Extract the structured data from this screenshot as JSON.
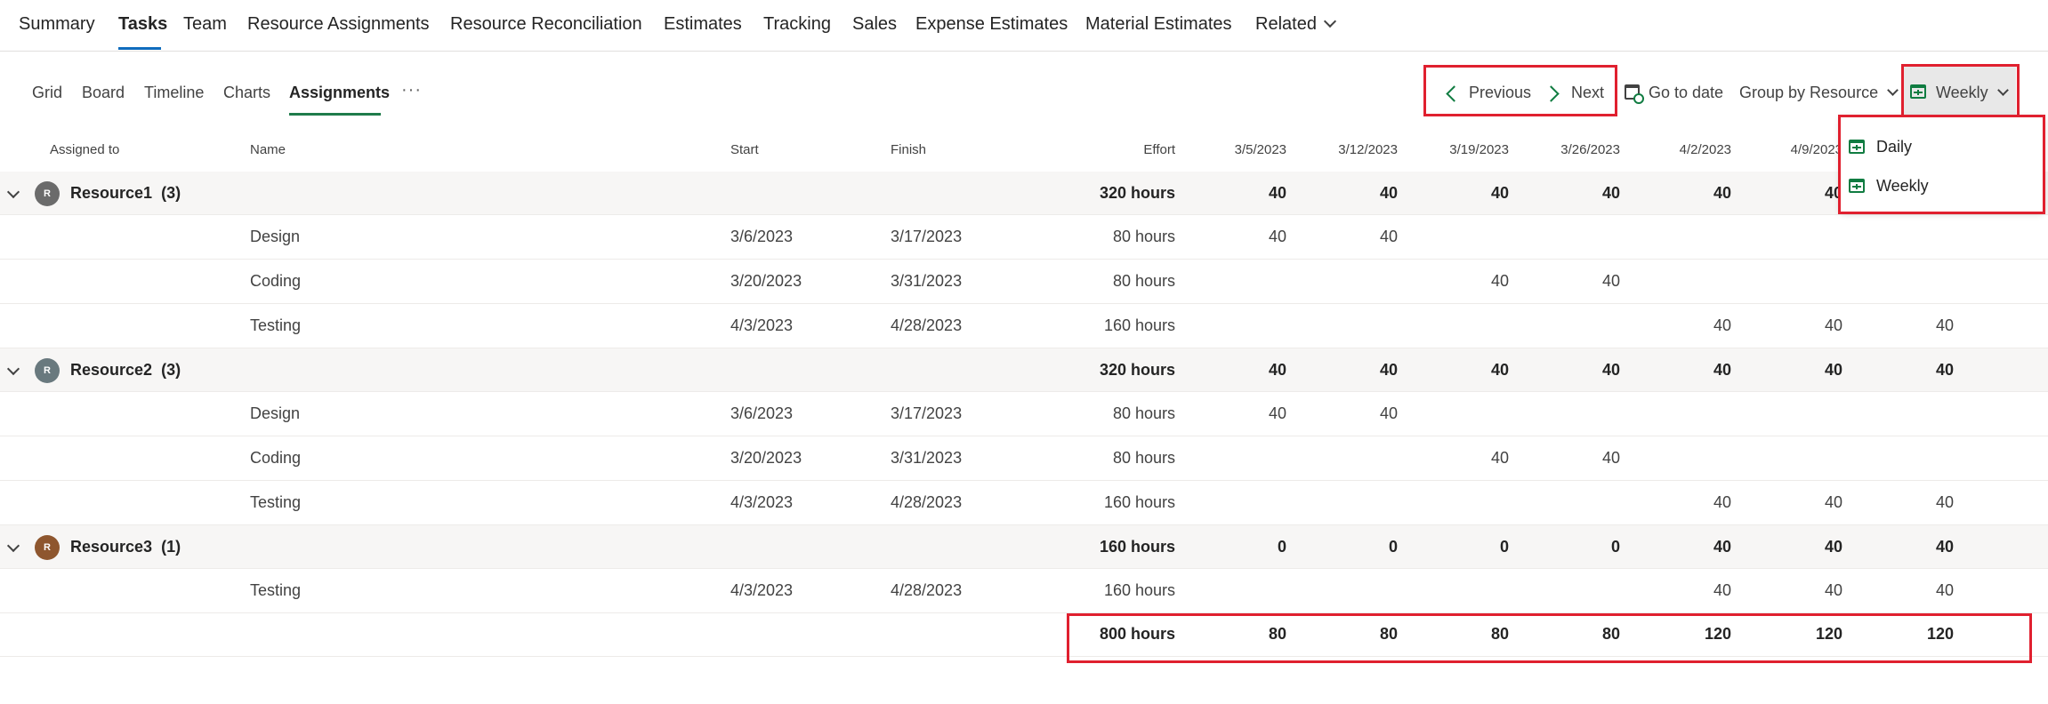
{
  "top_tabs": [
    "Summary",
    "Tasks",
    "Team",
    "Resource Assignments",
    "Resource Reconciliation",
    "Estimates",
    "Tracking",
    "Sales",
    "Expense Estimates",
    "Material Estimates",
    "Related"
  ],
  "sub_tabs": [
    "Grid",
    "Board",
    "Timeline",
    "Charts",
    "Assignments"
  ],
  "more_label": "···",
  "commands": {
    "previous": "Previous",
    "next": "Next",
    "go_to_date": "Go to date",
    "group_by": "Group by Resource",
    "period": "Weekly"
  },
  "dropdown": [
    "Daily",
    "Weekly"
  ],
  "columns": {
    "assigned_to": "Assigned to",
    "name": "Name",
    "start": "Start",
    "finish": "Finish",
    "effort": "Effort",
    "weeks": [
      "3/5/2023",
      "3/12/2023",
      "3/19/2023",
      "3/26/2023",
      "4/2/2023",
      "4/9/2023"
    ]
  },
  "groups": [
    {
      "name": "Resource1",
      "count": "(3)",
      "initial": "R",
      "avatar_color": "#6b6b6b",
      "effort": "320 hours",
      "weeks": [
        "40",
        "40",
        "40",
        "40",
        "40",
        "40",
        ""
      ],
      "tasks": [
        {
          "name": "Design",
          "start": "3/6/2023",
          "finish": "3/17/2023",
          "effort": "80 hours",
          "weeks": [
            "40",
            "40",
            "",
            "",
            "",
            "",
            ""
          ]
        },
        {
          "name": "Coding",
          "start": "3/20/2023",
          "finish": "3/31/2023",
          "effort": "80 hours",
          "weeks": [
            "",
            "",
            "40",
            "40",
            "",
            "",
            ""
          ]
        },
        {
          "name": "Testing",
          "start": "4/3/2023",
          "finish": "4/28/2023",
          "effort": "160 hours",
          "weeks": [
            "",
            "",
            "",
            "",
            "40",
            "40",
            "40"
          ]
        }
      ]
    },
    {
      "name": "Resource2",
      "count": "(3)",
      "initial": "R",
      "avatar_color": "#69797e",
      "effort": "320 hours",
      "weeks": [
        "40",
        "40",
        "40",
        "40",
        "40",
        "40",
        "40"
      ],
      "tasks": [
        {
          "name": "Design",
          "start": "3/6/2023",
          "finish": "3/17/2023",
          "effort": "80 hours",
          "weeks": [
            "40",
            "40",
            "",
            "",
            "",
            "",
            ""
          ]
        },
        {
          "name": "Coding",
          "start": "3/20/2023",
          "finish": "3/31/2023",
          "effort": "80 hours",
          "weeks": [
            "",
            "",
            "40",
            "40",
            "",
            "",
            ""
          ]
        },
        {
          "name": "Testing",
          "start": "4/3/2023",
          "finish": "4/28/2023",
          "effort": "160 hours",
          "weeks": [
            "",
            "",
            "",
            "",
            "40",
            "40",
            "40"
          ]
        }
      ]
    },
    {
      "name": "Resource3",
      "count": "(1)",
      "initial": "R",
      "avatar_color": "#8e562e",
      "effort": "160 hours",
      "weeks": [
        "0",
        "0",
        "0",
        "0",
        "40",
        "40",
        "40"
      ],
      "tasks": [
        {
          "name": "Testing",
          "start": "4/3/2023",
          "finish": "4/28/2023",
          "effort": "160 hours",
          "weeks": [
            "",
            "",
            "",
            "",
            "40",
            "40",
            "40"
          ]
        }
      ]
    }
  ],
  "totals": {
    "effort": "800 hours",
    "weeks": [
      "80",
      "80",
      "80",
      "80",
      "120",
      "120",
      "120"
    ]
  },
  "colors": {
    "highlight": "#e0202f",
    "accent": "#107c41",
    "tab_underline": "#0f6cbd"
  }
}
